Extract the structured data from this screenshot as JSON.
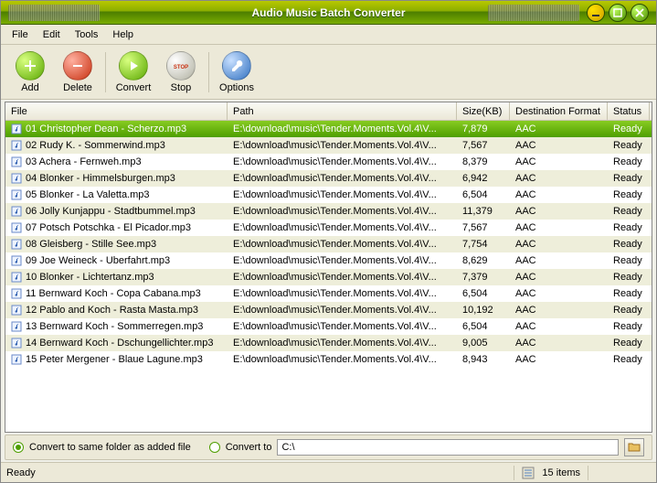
{
  "window": {
    "title": "Audio Music Batch Converter"
  },
  "menu": {
    "file": "File",
    "edit": "Edit",
    "tools": "Tools",
    "help": "Help"
  },
  "toolbar": {
    "add": "Add",
    "delete": "Delete",
    "convert": "Convert",
    "stop": "Stop",
    "options": "Options"
  },
  "columns": {
    "file": "File",
    "path": "Path",
    "size": "Size(KB)",
    "dest": "Destination Format",
    "status": "Status"
  },
  "rows": [
    {
      "file": "01 Christopher Dean - Scherzo.mp3",
      "path": "E:\\download\\music\\Tender.Moments.Vol.4\\V...",
      "size": "7,879",
      "dest": "AAC",
      "status": "Ready",
      "selected": true
    },
    {
      "file": "02 Rudy K. - Sommerwind.mp3",
      "path": "E:\\download\\music\\Tender.Moments.Vol.4\\V...",
      "size": "7,567",
      "dest": "AAC",
      "status": "Ready"
    },
    {
      "file": "03 Achera - Fernweh.mp3",
      "path": "E:\\download\\music\\Tender.Moments.Vol.4\\V...",
      "size": "8,379",
      "dest": "AAC",
      "status": "Ready"
    },
    {
      "file": "04 Blonker - Himmelsburgen.mp3",
      "path": "E:\\download\\music\\Tender.Moments.Vol.4\\V...",
      "size": "6,942",
      "dest": "AAC",
      "status": "Ready"
    },
    {
      "file": "05 Blonker - La Valetta.mp3",
      "path": "E:\\download\\music\\Tender.Moments.Vol.4\\V...",
      "size": "6,504",
      "dest": "AAC",
      "status": "Ready"
    },
    {
      "file": "06 Jolly Kunjappu - Stadtbummel.mp3",
      "path": "E:\\download\\music\\Tender.Moments.Vol.4\\V...",
      "size": "11,379",
      "dest": "AAC",
      "status": "Ready"
    },
    {
      "file": "07 Potsch Potschka - El Picador.mp3",
      "path": "E:\\download\\music\\Tender.Moments.Vol.4\\V...",
      "size": "7,567",
      "dest": "AAC",
      "status": "Ready"
    },
    {
      "file": "08 Gleisberg - Stille See.mp3",
      "path": "E:\\download\\music\\Tender.Moments.Vol.4\\V...",
      "size": "7,754",
      "dest": "AAC",
      "status": "Ready"
    },
    {
      "file": "09 Joe Weineck - Uberfahrt.mp3",
      "path": "E:\\download\\music\\Tender.Moments.Vol.4\\V...",
      "size": "8,629",
      "dest": "AAC",
      "status": "Ready"
    },
    {
      "file": "10 Blonker - Lichtertanz.mp3",
      "path": "E:\\download\\music\\Tender.Moments.Vol.4\\V...",
      "size": "7,379",
      "dest": "AAC",
      "status": "Ready"
    },
    {
      "file": "11 Bernward Koch - Copa Cabana.mp3",
      "path": "E:\\download\\music\\Tender.Moments.Vol.4\\V...",
      "size": "6,504",
      "dest": "AAC",
      "status": "Ready"
    },
    {
      "file": "12 Pablo and Koch - Rasta Masta.mp3",
      "path": "E:\\download\\music\\Tender.Moments.Vol.4\\V...",
      "size": "10,192",
      "dest": "AAC",
      "status": "Ready"
    },
    {
      "file": "13 Bernward Koch - Sommerregen.mp3",
      "path": "E:\\download\\music\\Tender.Moments.Vol.4\\V...",
      "size": "6,504",
      "dest": "AAC",
      "status": "Ready"
    },
    {
      "file": "14 Bernward Koch - Dschungellichter.mp3",
      "path": "E:\\download\\music\\Tender.Moments.Vol.4\\V...",
      "size": "9,005",
      "dest": "AAC",
      "status": "Ready"
    },
    {
      "file": "15 Peter Mergener - Blaue Lagune.mp3",
      "path": "E:\\download\\music\\Tender.Moments.Vol.4\\V...",
      "size": "8,943",
      "dest": "AAC",
      "status": "Ready"
    }
  ],
  "options": {
    "same_folder_label": "Convert to same folder as added file",
    "convert_to_label": "Convert to",
    "path_value": "C:\\",
    "same_folder_checked": true
  },
  "status": {
    "ready": "Ready",
    "items": "15 items"
  }
}
